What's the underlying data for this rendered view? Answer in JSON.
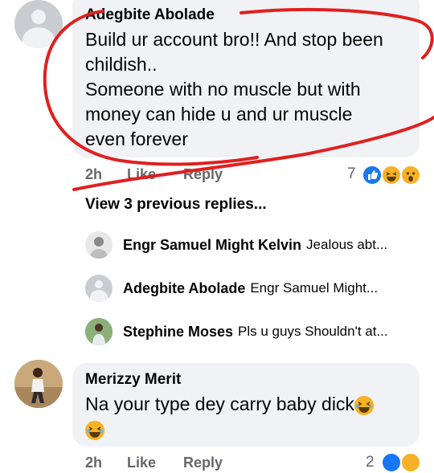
{
  "comment1": {
    "author": "Adegbite Abolade",
    "lines": [
      "Build ur account bro!! And stop been",
      "childish..",
      "Someone with no muscle but with",
      "money can hide u and ur muscle",
      "even forever"
    ],
    "time": "2h",
    "like_label": "Like",
    "reply_label": "Reply",
    "reaction_count": "7"
  },
  "view_previous": "View 3 previous replies...",
  "replies": [
    {
      "author": "Engr Samuel Might Kelvin",
      "text": "Jealous abt..."
    },
    {
      "author": "Adegbite Abolade",
      "text": "Engr Samuel Might..."
    },
    {
      "author": "Stephine Moses",
      "text": "Pls u guys Shouldn't at..."
    }
  ],
  "comment2": {
    "author": "Merizzy Merit",
    "text": "Na your type dey carry baby dick",
    "time": "2h",
    "like_label": "Like",
    "reply_label": "Reply",
    "reaction_count": "2"
  },
  "colors": {
    "bubble": "#f0f2f5",
    "meta_gray": "#65676b",
    "like_blue": "#1877f2",
    "emoji_yellow": "#f7b125",
    "annotation_red": "#e02020"
  },
  "icons": [
    "default-avatar-icon",
    "like-reaction-icon",
    "haha-reaction-icon",
    "wow-reaction-icon",
    "laughing-emoji-icon"
  ]
}
